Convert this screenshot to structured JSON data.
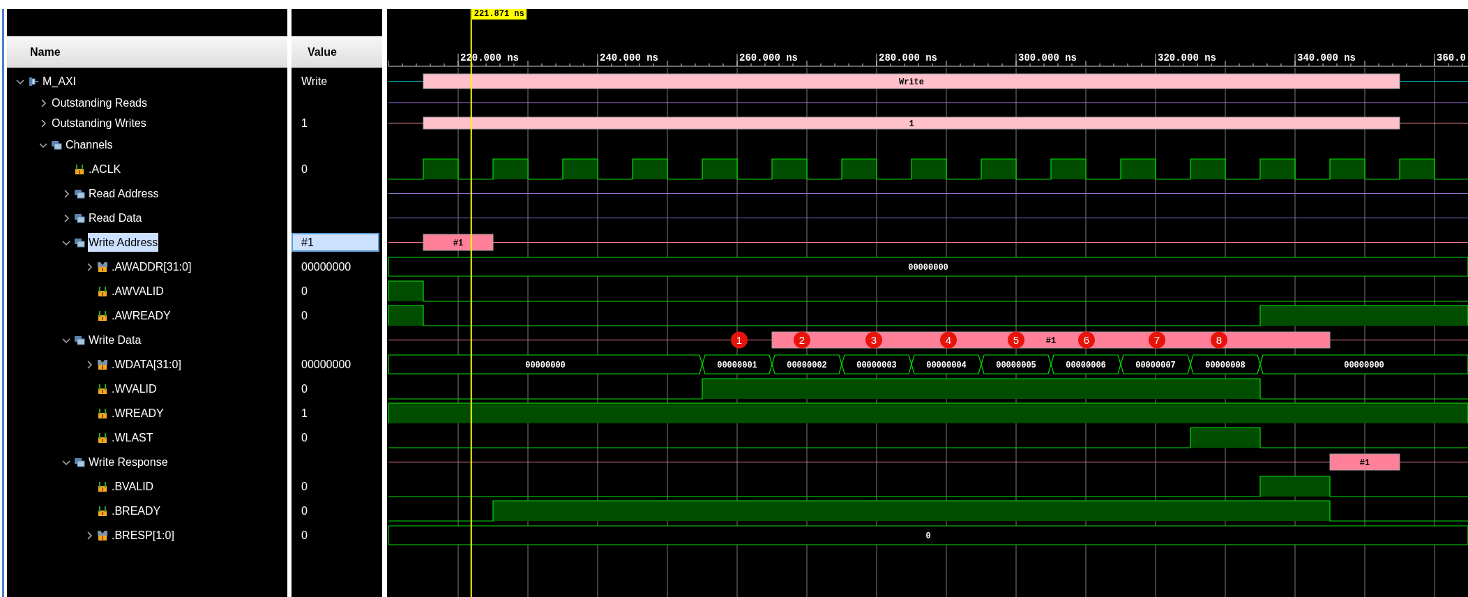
{
  "columns": [
    "Name",
    "Value"
  ],
  "signals": [
    {
      "name": "M_AXI",
      "kind": "interface",
      "value": "Write",
      "expanded": true,
      "selected": false,
      "wave": {
        "kind": "transaction",
        "segments": [
          "Write"
        ]
      },
      "children": [
        {
          "name": "Outstanding Reads",
          "expanded": false,
          "selected": false,
          "wave": {
            "kind": "line"
          }
        },
        {
          "name": "Outstanding Writes",
          "value": "1",
          "expanded": false,
          "selected": false,
          "wave": {
            "kind": "transaction",
            "segments": [
              "1"
            ]
          }
        },
        {
          "name": "Channels",
          "kind": "group",
          "expanded": true,
          "selected": false,
          "children": [
            {
              "name": ".ACLK",
              "kind": "bit",
              "value": "0",
              "selected": false,
              "wave": {
                "kind": "clock"
              }
            },
            {
              "name": "Read Address",
              "kind": "group",
              "expanded": false,
              "selected": false,
              "wave": {
                "kind": "line"
              }
            },
            {
              "name": "Read Data",
              "kind": "group",
              "expanded": false,
              "selected": false,
              "wave": {
                "kind": "line"
              }
            },
            {
              "name": "Write Address",
              "kind": "group",
              "value": "#1",
              "expanded": true,
              "selected": true,
              "wave": {
                "kind": "transaction",
                "segments": [
                  "#1"
                ]
              },
              "children": [
                {
                  "name": ".AWADDR[31:0]",
                  "kind": "bus",
                  "value": "00000000",
                  "expanded": false,
                  "selected": false,
                  "wave": {
                    "kind": "bus",
                    "segments": [
                      "00000000"
                    ]
                  }
                },
                {
                  "name": ".AWVALID",
                  "kind": "bit",
                  "value": "0",
                  "selected": false,
                  "wave": {
                    "kind": "bit"
                  }
                },
                {
                  "name": ".AWREADY",
                  "kind": "bit",
                  "value": "0",
                  "selected": false,
                  "wave": {
                    "kind": "bit"
                  }
                }
              ]
            },
            {
              "name": "Write Data",
              "kind": "group",
              "expanded": true,
              "selected": false,
              "wave": {
                "kind": "transaction",
                "segments": [
                  "#1"
                ]
              },
              "children": [
                {
                  "name": ".WDATA[31:0]",
                  "kind": "bus",
                  "value": "00000000",
                  "expanded": false,
                  "selected": false,
                  "wave": {
                    "kind": "bus",
                    "segments": [
                      "00000000",
                      "00000001",
                      "00000002",
                      "00000003",
                      "00000004",
                      "00000005",
                      "00000006",
                      "00000007",
                      "00000008",
                      "00000000"
                    ]
                  }
                },
                {
                  "name": ".WVALID",
                  "kind": "bit",
                  "value": "0",
                  "selected": false,
                  "wave": {
                    "kind": "bit"
                  }
                },
                {
                  "name": ".WREADY",
                  "kind": "bit",
                  "value": "1",
                  "selected": false,
                  "wave": {
                    "kind": "bit"
                  }
                },
                {
                  "name": ".WLAST",
                  "kind": "bit",
                  "value": "0",
                  "selected": false,
                  "wave": {
                    "kind": "bit"
                  }
                }
              ]
            },
            {
              "name": "Write Response",
              "kind": "group",
              "expanded": true,
              "selected": false,
              "wave": {
                "kind": "transaction",
                "segments": [
                  "#1"
                ]
              },
              "children": [
                {
                  "name": ".BVALID",
                  "kind": "bit",
                  "value": "0",
                  "selected": false,
                  "wave": {
                    "kind": "bit"
                  }
                },
                {
                  "name": ".BREADY",
                  "kind": "bit",
                  "value": "0",
                  "selected": false,
                  "wave": {
                    "kind": "bit"
                  }
                },
                {
                  "name": ".BRESP[1:0]",
                  "kind": "bus",
                  "value": "0",
                  "expanded": false,
                  "selected": false,
                  "wave": {
                    "kind": "bus",
                    "segments": [
                      "0"
                    ]
                  }
                }
              ]
            }
          ]
        }
      ]
    }
  ],
  "waveform": {
    "time_labels": [
      "220.000 ns",
      "240.000 ns",
      "260.000 ns",
      "280.000 ns",
      "300.000 ns",
      "320.000 ns",
      "340.000 ns",
      "360.0"
    ],
    "cursor": "221.871 ns",
    "markers": [
      "1",
      "2",
      "3",
      "4",
      "5",
      "6",
      "7",
      "8"
    ]
  }
}
